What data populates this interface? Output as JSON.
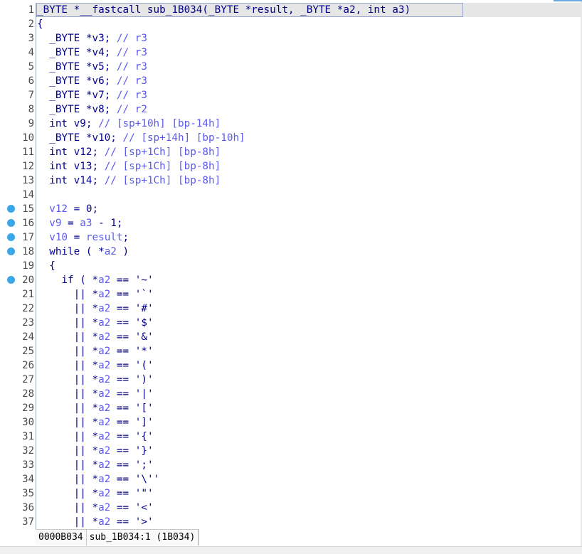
{
  "gutter": {
    "line_numbers": [
      "1",
      "2",
      "3",
      "4",
      "5",
      "6",
      "7",
      "8",
      "9",
      "10",
      "11",
      "12",
      "13",
      "14",
      "15",
      "16",
      "17",
      "18",
      "19",
      "20",
      "21",
      "22",
      "23",
      "24",
      "25",
      "26",
      "27",
      "28",
      "29",
      "30",
      "31",
      "32",
      "33",
      "34",
      "35",
      "36",
      "37"
    ],
    "breakpoint_lines": [
      15,
      16,
      17,
      18,
      20
    ],
    "breakpoint_color": "#3aa7e6"
  },
  "code": {
    "lines": [
      [
        [
          "_BYTE *__fastcall sub_1B034(_BYTE *result, _BYTE *a2, int a3)",
          "pl"
        ]
      ],
      [
        [
          "{",
          "pl"
        ]
      ],
      [
        [
          "  _BYTE *v3; ",
          "pl"
        ],
        [
          "// r3",
          "cm"
        ]
      ],
      [
        [
          "  _BYTE *v4; ",
          "pl"
        ],
        [
          "// r3",
          "cm"
        ]
      ],
      [
        [
          "  _BYTE *v5; ",
          "pl"
        ],
        [
          "// r3",
          "cm"
        ]
      ],
      [
        [
          "  _BYTE *v6; ",
          "pl"
        ],
        [
          "// r3",
          "cm"
        ]
      ],
      [
        [
          "  _BYTE *v7; ",
          "pl"
        ],
        [
          "// r3",
          "cm"
        ]
      ],
      [
        [
          "  _BYTE *v8; ",
          "pl"
        ],
        [
          "// r2",
          "cm"
        ]
      ],
      [
        [
          "  int v9; ",
          "pl"
        ],
        [
          "// [sp+10h] [bp-14h]",
          "cm"
        ]
      ],
      [
        [
          "  _BYTE *v10; ",
          "pl"
        ],
        [
          "// [sp+14h] [bp-10h]",
          "cm"
        ]
      ],
      [
        [
          "  int v12; ",
          "pl"
        ],
        [
          "// [sp+1Ch] [bp-8h]",
          "cm"
        ]
      ],
      [
        [
          "  int v13; ",
          "pl"
        ],
        [
          "// [sp+1Ch] [bp-8h]",
          "cm"
        ]
      ],
      [
        [
          "  int v14; ",
          "pl"
        ],
        [
          "// [sp+1Ch] [bp-8h]",
          "cm"
        ]
      ],
      [
        [
          "",
          "pl"
        ]
      ],
      [
        [
          "  ",
          "pl"
        ],
        [
          "v12",
          "vr"
        ],
        [
          " = 0;",
          "pl"
        ]
      ],
      [
        [
          "  ",
          "pl"
        ],
        [
          "v9",
          "vr"
        ],
        [
          " = ",
          "pl"
        ],
        [
          "a3",
          "vr"
        ],
        [
          " - 1;",
          "pl"
        ]
      ],
      [
        [
          "  ",
          "pl"
        ],
        [
          "v10",
          "vr"
        ],
        [
          " = ",
          "pl"
        ],
        [
          "result",
          "vr"
        ],
        [
          ";",
          "pl"
        ]
      ],
      [
        [
          "  while ( *",
          "pl"
        ],
        [
          "a2",
          "vr"
        ],
        [
          " )",
          "pl"
        ]
      ],
      [
        [
          "  {",
          "pl"
        ]
      ],
      [
        [
          "    if ( *",
          "pl"
        ],
        [
          "a2",
          "vr"
        ],
        [
          " == '~'",
          "pl"
        ]
      ],
      [
        [
          "      || *",
          "pl"
        ],
        [
          "a2",
          "vr"
        ],
        [
          " == '`'",
          "pl"
        ]
      ],
      [
        [
          "      || *",
          "pl"
        ],
        [
          "a2",
          "vr"
        ],
        [
          " == '#'",
          "pl"
        ]
      ],
      [
        [
          "      || *",
          "pl"
        ],
        [
          "a2",
          "vr"
        ],
        [
          " == '$'",
          "pl"
        ]
      ],
      [
        [
          "      || *",
          "pl"
        ],
        [
          "a2",
          "vr"
        ],
        [
          " == '&'",
          "pl"
        ]
      ],
      [
        [
          "      || *",
          "pl"
        ],
        [
          "a2",
          "vr"
        ],
        [
          " == '*'",
          "pl"
        ]
      ],
      [
        [
          "      || *",
          "pl"
        ],
        [
          "a2",
          "vr"
        ],
        [
          " == '('",
          "pl"
        ]
      ],
      [
        [
          "      || *",
          "pl"
        ],
        [
          "a2",
          "vr"
        ],
        [
          " == ')'",
          "pl"
        ]
      ],
      [
        [
          "      || *",
          "pl"
        ],
        [
          "a2",
          "vr"
        ],
        [
          " == '|'",
          "pl"
        ]
      ],
      [
        [
          "      || *",
          "pl"
        ],
        [
          "a2",
          "vr"
        ],
        [
          " == '['",
          "pl"
        ]
      ],
      [
        [
          "      || *",
          "pl"
        ],
        [
          "a2",
          "vr"
        ],
        [
          " == ']'",
          "pl"
        ]
      ],
      [
        [
          "      || *",
          "pl"
        ],
        [
          "a2",
          "vr"
        ],
        [
          " == '{'",
          "pl"
        ]
      ],
      [
        [
          "      || *",
          "pl"
        ],
        [
          "a2",
          "vr"
        ],
        [
          " == '}'",
          "pl"
        ]
      ],
      [
        [
          "      || *",
          "pl"
        ],
        [
          "a2",
          "vr"
        ],
        [
          " == ';'",
          "pl"
        ]
      ],
      [
        [
          "      || *",
          "pl"
        ],
        [
          "a2",
          "vr"
        ],
        [
          " == '\\''",
          "pl"
        ]
      ],
      [
        [
          "      || *",
          "pl"
        ],
        [
          "a2",
          "vr"
        ],
        [
          " == '\"'",
          "pl"
        ]
      ],
      [
        [
          "      || *",
          "pl"
        ],
        [
          "a2",
          "vr"
        ],
        [
          " == '<'",
          "pl"
        ]
      ],
      [
        [
          "      || *",
          "pl"
        ],
        [
          "a2",
          "vr"
        ],
        [
          " == '>'",
          "pl"
        ]
      ]
    ]
  },
  "statusbar": {
    "address": "0000B034",
    "location": "sub_1B034:1 (1B034)"
  },
  "colors": {
    "code_text": "#00008b",
    "variable": "#5a5af0",
    "comment": "#5a5af0",
    "breakpoint": "#3aa7e6"
  }
}
